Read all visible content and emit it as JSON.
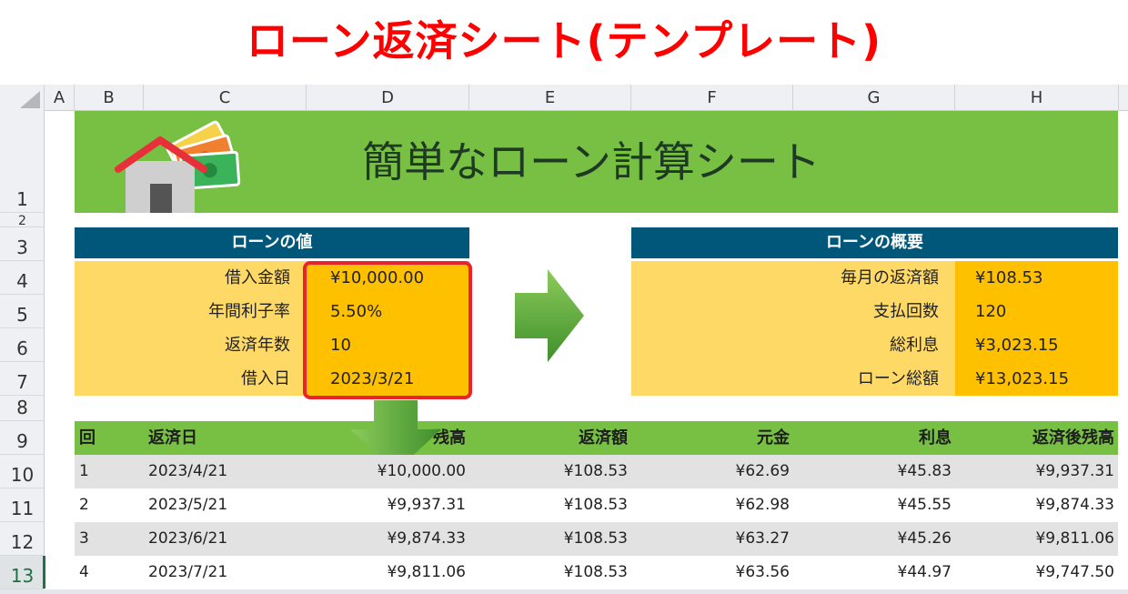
{
  "title": "ローン返済シート(テンプレート)",
  "columns": [
    "A",
    "B",
    "C",
    "D",
    "E",
    "F",
    "G",
    "H"
  ],
  "rows": [
    "1",
    "2",
    "3",
    "4",
    "5",
    "6",
    "7",
    "8",
    "9",
    "10",
    "11",
    "12",
    "13"
  ],
  "banner_title": "簡単なローン計算シート",
  "loan_values": {
    "header": "ローンの値",
    "items": [
      {
        "label": "借入金額",
        "value": "¥10,000.00"
      },
      {
        "label": "年間利子率",
        "value": "5.50%"
      },
      {
        "label": "返済年数",
        "value": "10"
      },
      {
        "label": "借入日",
        "value": "2023/3/21"
      }
    ]
  },
  "loan_summary": {
    "header": "ローンの概要",
    "items": [
      {
        "label": "毎月の返済額",
        "value": "¥108.53"
      },
      {
        "label": "支払回数",
        "value": "120"
      },
      {
        "label": "総利息",
        "value": "¥3,023.15"
      },
      {
        "label": "ローン総額",
        "value": "¥13,023.15"
      }
    ]
  },
  "schedule": {
    "headers": [
      "回",
      "返済日",
      "残高",
      "返済額",
      "元金",
      "利息",
      "返済後残高"
    ],
    "rows": [
      [
        "1",
        "2023/4/21",
        "¥10,000.00",
        "¥108.53",
        "¥62.69",
        "¥45.83",
        "¥9,937.31"
      ],
      [
        "2",
        "2023/5/21",
        "¥9,937.31",
        "¥108.53",
        "¥62.98",
        "¥45.55",
        "¥9,874.33"
      ],
      [
        "3",
        "2023/6/21",
        "¥9,874.33",
        "¥108.53",
        "¥63.27",
        "¥45.26",
        "¥9,811.06"
      ],
      [
        "4",
        "2023/7/21",
        "¥9,811.06",
        "¥108.53",
        "¥63.56",
        "¥44.97",
        "¥9,747.50"
      ]
    ]
  },
  "colors": {
    "title_red": "#ff0000",
    "banner_green": "#77c043",
    "header_blue": "#00577a",
    "yellow": "#ffd966",
    "orange": "#ffc000",
    "highlight_red": "#e8232a"
  },
  "icons": [
    "house-icon",
    "money-icon",
    "right-arrow-icon",
    "down-arrow-icon"
  ]
}
